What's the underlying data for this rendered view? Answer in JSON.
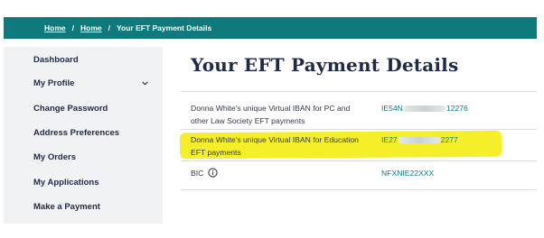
{
  "breadcrumb": {
    "items": [
      "Home",
      "Home"
    ],
    "separator": "/",
    "current": "Your EFT Payment Details"
  },
  "sidebar": {
    "items": [
      {
        "label": "Dashboard"
      },
      {
        "label": "My Profile",
        "icon": "chevron-down-icon"
      },
      {
        "label": "Change Password"
      },
      {
        "label": "Address Preferences"
      },
      {
        "label": "My Orders"
      },
      {
        "label": "My Applications"
      },
      {
        "label": "Make a Payment"
      }
    ]
  },
  "main": {
    "title": "Your EFT Payment Details",
    "rows": [
      {
        "label": "Donna White's unique Virtual IBAN for PC and other Law Society EFT payments",
        "value_prefix": "IE54N",
        "value_suffix": "12276",
        "highlighted": false
      },
      {
        "label": "Donna White's unique Virtual IBAN for Education EFT payments",
        "value_prefix": "IE27",
        "value_suffix": "2277",
        "highlighted": true
      },
      {
        "label": "BIC",
        "value": "NFXNIE22XXX",
        "icon": "info-icon"
      }
    ]
  },
  "colors": {
    "brand_teal": "#0e7a7c",
    "nav_text": "#1f2a44",
    "sidebar_bg": "#f1f2f4",
    "highlight": "#f5ef2a"
  }
}
